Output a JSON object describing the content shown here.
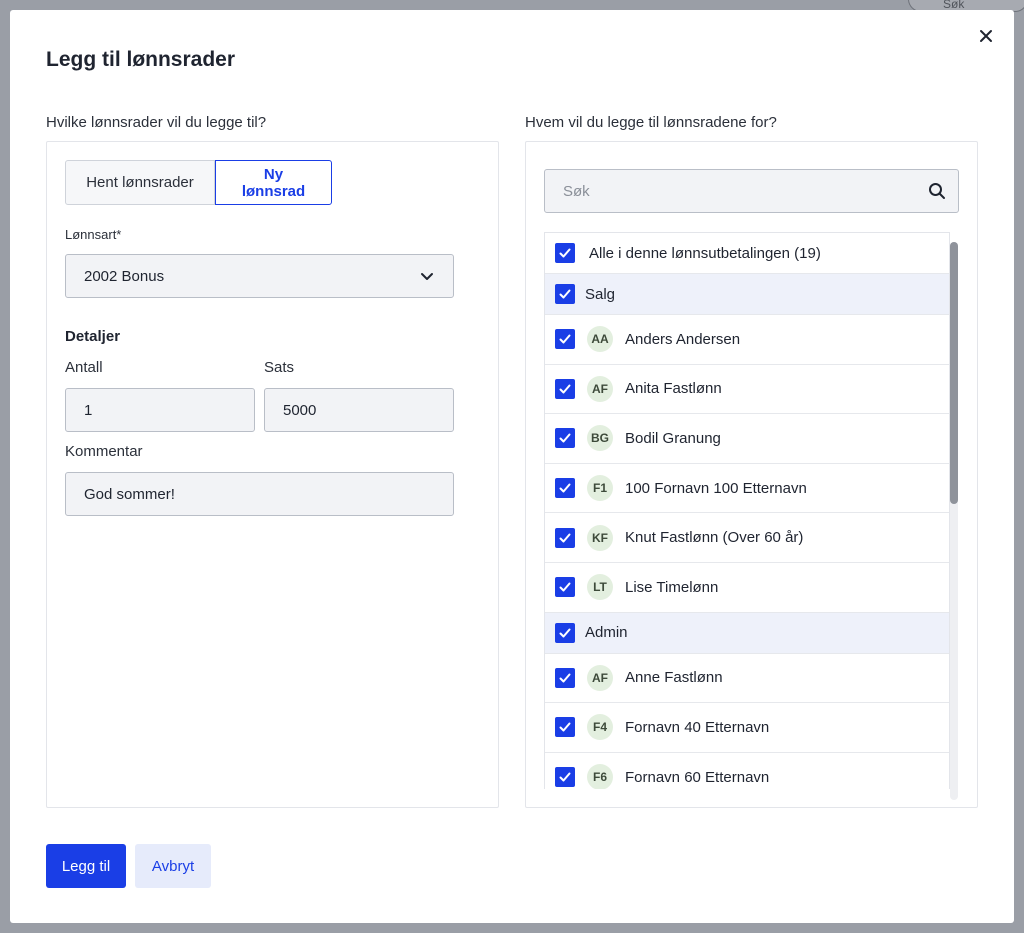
{
  "background": {
    "search_text": "Søk"
  },
  "modal": {
    "title": "Legg til lønnsrader",
    "left_column_label": "Hvilke lønnsrader vil du legge til?",
    "right_column_label": "Hvem vil du legge til lønnsradene for?"
  },
  "left": {
    "tabs": [
      {
        "label": "Hent lønnsrader",
        "active": false
      },
      {
        "label": "Ny lønnsrad",
        "active": true
      }
    ],
    "lonnsart_label": "Lønnsart*",
    "lonnsart_value": "2002 Bonus",
    "details_heading": "Detaljer",
    "antall_label": "Antall",
    "antall_value": "1",
    "sats_label": "Sats",
    "sats_value": "5000",
    "kommentar_label": "Kommentar",
    "kommentar_value": "God sommer!"
  },
  "right": {
    "search_placeholder": "Søk",
    "all_label": "Alle i denne lønnsutbetalingen (19)",
    "groups": [
      {
        "name": "Salg",
        "employees": [
          {
            "initials": "AA",
            "name": "Anders Andersen"
          },
          {
            "initials": "AF",
            "name": "Anita Fastlønn"
          },
          {
            "initials": "BG",
            "name": "Bodil Granung"
          },
          {
            "initials": "F1",
            "name": "100 Fornavn 100 Etternavn"
          },
          {
            "initials": "KF",
            "name": "Knut Fastlønn (Over 60 år)"
          },
          {
            "initials": "LT",
            "name": "Lise Timelønn"
          }
        ]
      },
      {
        "name": "Admin",
        "employees": [
          {
            "initials": "AF",
            "name": "Anne Fastlønn"
          },
          {
            "initials": "F4",
            "name": "Fornavn 40 Etternavn"
          },
          {
            "initials": "F6",
            "name": "Fornavn 60 Etternavn"
          }
        ]
      }
    ]
  },
  "footer": {
    "primary_label": "Legg til",
    "secondary_label": "Avbryt"
  },
  "colors": {
    "accent": "#1a3ee6",
    "group_row_bg": "#eef1fa"
  }
}
